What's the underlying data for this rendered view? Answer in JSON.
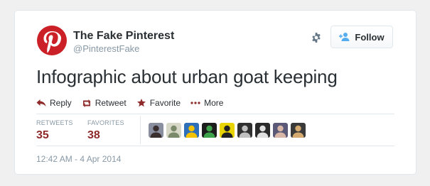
{
  "profile": {
    "display_name": "The Fake Pinterest",
    "handle": "@PinterestFake",
    "avatar_color": "#cb2027"
  },
  "follow_button": {
    "label": "Follow"
  },
  "tweet": {
    "text": "Infographic about urban goat keeping",
    "timestamp": "12:42 AM - 4 Apr 2014"
  },
  "actions": [
    {
      "label": "Reply",
      "icon": "reply-icon"
    },
    {
      "label": "Retweet",
      "icon": "retweet-icon"
    },
    {
      "label": "Favorite",
      "icon": "star-icon"
    },
    {
      "label": "More",
      "icon": "more-icon"
    }
  ],
  "stats": {
    "retweets": {
      "label": "RETWEETS",
      "count": "35"
    },
    "favorites": {
      "label": "FAVORITES",
      "count": "38"
    }
  },
  "favoriters": [
    {
      "name": "favoriter-1",
      "bg": "#8a8fa0",
      "fg": "#3a2f2f"
    },
    {
      "name": "favoriter-2",
      "bg": "#d8d8c8",
      "fg": "#7a8a6a"
    },
    {
      "name": "favoriter-3",
      "bg": "#2d6fb8",
      "fg": "#f5c200"
    },
    {
      "name": "favoriter-4",
      "bg": "#1d1d1d",
      "fg": "#3ea34a"
    },
    {
      "name": "favoriter-5",
      "bg": "#e8d400",
      "fg": "#222222"
    },
    {
      "name": "favoriter-6",
      "bg": "#303030",
      "fg": "#c0c0c0"
    },
    {
      "name": "favoriter-7",
      "bg": "#2a2a2a",
      "fg": "#e0e0e0"
    },
    {
      "name": "favoriter-8",
      "bg": "#5a5a78",
      "fg": "#d9b7a8"
    },
    {
      "name": "favoriter-9",
      "bg": "#3a3a3a",
      "fg": "#d4aa70"
    }
  ],
  "colors": {
    "brand_red": "#cb2027",
    "action_icon": "#8f2a2a",
    "count": "#8f2a2a"
  }
}
